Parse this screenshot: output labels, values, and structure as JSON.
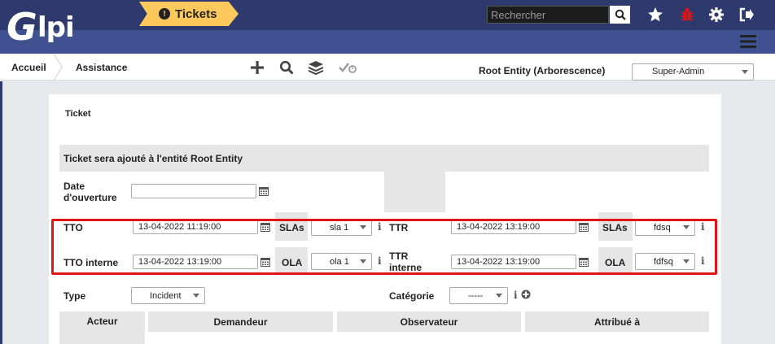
{
  "header": {
    "logo_text": "Glpi",
    "search_placeholder": "Rechercher",
    "icons": [
      "search-icon",
      "star-icon",
      "bug-icon",
      "gear-icon",
      "logout-icon",
      "menu-icon"
    ]
  },
  "breadcrumb": {
    "items": [
      "Accueil",
      "Assistance",
      "Tickets"
    ],
    "actions": [
      "add-icon",
      "search-icon",
      "layers-icon",
      "validation-icon"
    ]
  },
  "entity": {
    "label": "Root Entity (Arborescence)",
    "profile": "Super-Admin"
  },
  "form": {
    "title": "Ticket",
    "section_header": "Ticket sera ajouté à l'entité Root Entity",
    "date_opening_label": "Date d'ouverture",
    "date_opening_value": "",
    "tto_label": "TTO",
    "tto_value": "13-04-2022 11:19:00",
    "tto_slas_label": "SLAs",
    "tto_slas_value": "sla 1",
    "ttr_label": "TTR",
    "ttr_value": "13-04-2022 13:19:00",
    "ttr_slas_label": "SLAs",
    "ttr_slas_value": "fdsq",
    "tto_internal_label": "TTO interne",
    "tto_internal_value": "13-04-2022 13:19:00",
    "tto_ola_label": "OLA",
    "tto_ola_value": "ola 1",
    "ttr_internal_label": "TTR interne",
    "ttr_internal_value": "13-04-2022 13:19:00",
    "ttr_ola_label": "OLA",
    "ttr_ola_value": "fdfsq",
    "type_label": "Type",
    "type_value": "Incident",
    "category_label": "Catégorie",
    "category_value": "-----"
  },
  "actors_table": {
    "headers": [
      "Acteur",
      "Demandeur",
      "Observateur",
      "Attribué à"
    ]
  },
  "colors": {
    "header_dark": "#2e3a6e",
    "header_sub": "#3f5190",
    "tickets_crumb": "#fec95c",
    "highlight_box": "#e01515",
    "bug_icon": "#e01515"
  }
}
